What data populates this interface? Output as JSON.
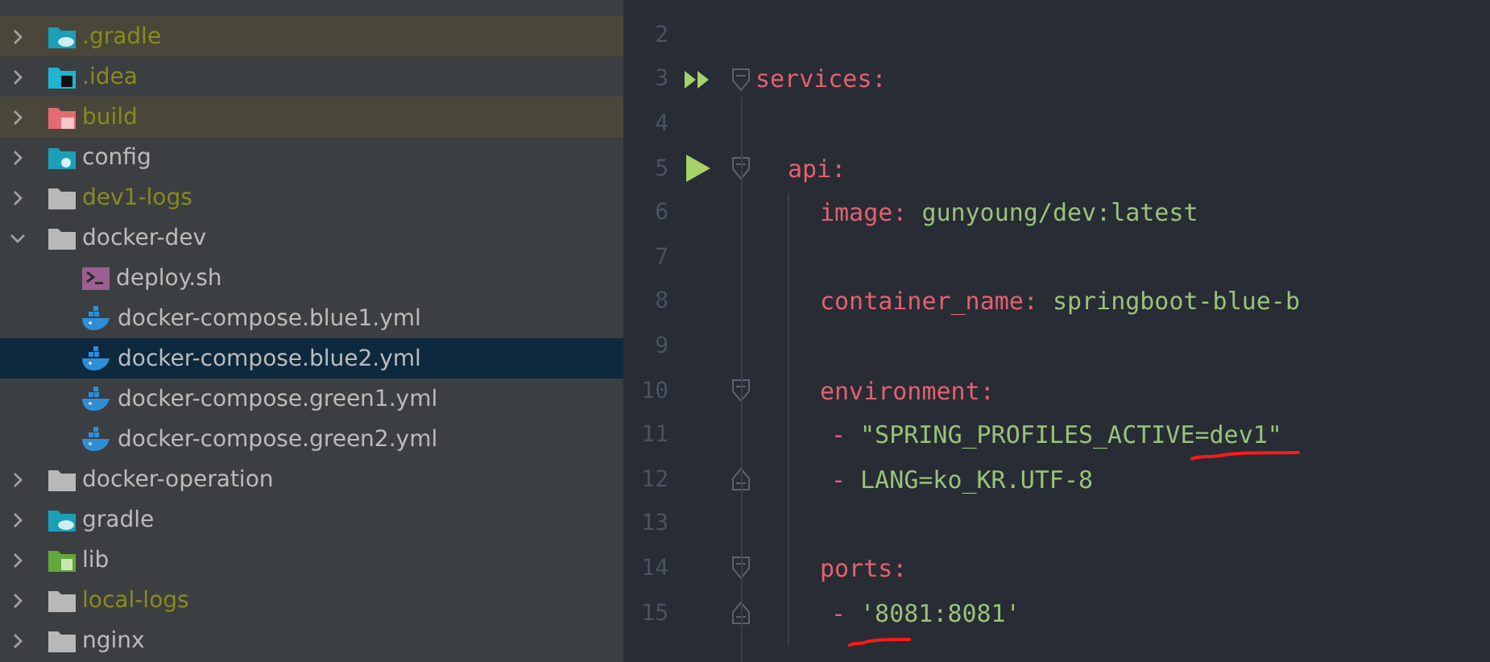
{
  "project_tree": {
    "items": [
      {
        "name": ".gradle",
        "kind": "gradle-folder",
        "expanded": false,
        "ignored": true,
        "highlighted": true,
        "selected": false
      },
      {
        "name": ".idea",
        "kind": "idea-folder",
        "expanded": false,
        "ignored": true,
        "highlighted": false,
        "selected": false
      },
      {
        "name": "build",
        "kind": "build-folder",
        "expanded": false,
        "ignored": true,
        "highlighted": true,
        "selected": false
      },
      {
        "name": "config",
        "kind": "config-folder",
        "expanded": false,
        "ignored": false,
        "highlighted": false,
        "selected": false
      },
      {
        "name": "dev1-logs",
        "kind": "folder",
        "expanded": false,
        "ignored": true,
        "highlighted": false,
        "selected": false
      },
      {
        "name": "docker-dev",
        "kind": "folder",
        "expanded": true,
        "ignored": false,
        "highlighted": false,
        "selected": false,
        "children": [
          {
            "name": "deploy.sh",
            "kind": "shell",
            "ignored": false,
            "highlighted": false,
            "selected": false
          },
          {
            "name": "docker-compose.blue1.yml",
            "kind": "docker",
            "ignored": false,
            "highlighted": false,
            "selected": false
          },
          {
            "name": "docker-compose.blue2.yml",
            "kind": "docker",
            "ignored": false,
            "highlighted": false,
            "selected": true
          },
          {
            "name": "docker-compose.green1.yml",
            "kind": "docker",
            "ignored": false,
            "highlighted": false,
            "selected": false
          },
          {
            "name": "docker-compose.green2.yml",
            "kind": "docker",
            "ignored": false,
            "highlighted": false,
            "selected": false
          }
        ]
      },
      {
        "name": "docker-operation",
        "kind": "folder",
        "expanded": false,
        "ignored": false,
        "highlighted": false,
        "selected": false
      },
      {
        "name": "gradle",
        "kind": "gradle-folder",
        "expanded": false,
        "ignored": false,
        "highlighted": false,
        "selected": false
      },
      {
        "name": "lib",
        "kind": "lib-folder",
        "expanded": false,
        "ignored": false,
        "highlighted": false,
        "selected": false
      },
      {
        "name": "local-logs",
        "kind": "folder",
        "expanded": false,
        "ignored": true,
        "highlighted": false,
        "selected": false
      },
      {
        "name": "nginx",
        "kind": "folder",
        "expanded": false,
        "ignored": false,
        "highlighted": false,
        "selected": false
      }
    ]
  },
  "editor": {
    "lines": [
      {
        "number": "2",
        "kind": "blank"
      },
      {
        "number": "3",
        "kind": "root",
        "run": {
          "kind": "run-all"
        },
        "fold": {
          "kind": "open"
        },
        "key": "services:"
      },
      {
        "number": "4",
        "kind": "blank"
      },
      {
        "number": "5",
        "kind": "service",
        "run": {
          "kind": "run"
        },
        "fold": {
          "kind": "open"
        },
        "key": "api:"
      },
      {
        "number": "6",
        "kind": "prop",
        "key": "image:",
        "value": "gunyoung/dev:latest"
      },
      {
        "number": "7",
        "kind": "blank"
      },
      {
        "number": "8",
        "kind": "prop",
        "key": "container_name:",
        "value": "springboot-blue-b"
      },
      {
        "number": "9",
        "kind": "blank"
      },
      {
        "number": "10",
        "kind": "prop",
        "fold": {
          "kind": "open"
        },
        "key": "environment:"
      },
      {
        "number": "11",
        "kind": "item",
        "dash": "-",
        "value": "\"SPRING_PROFILES_ACTIVE=dev1\"",
        "underlined": true
      },
      {
        "number": "12",
        "kind": "item",
        "fold": {
          "kind": "close"
        },
        "dash": "-",
        "value": "LANG=ko_KR.UTF-8"
      },
      {
        "number": "13",
        "kind": "blank"
      },
      {
        "number": "14",
        "kind": "prop",
        "fold": {
          "kind": "open"
        },
        "key": "ports:"
      },
      {
        "number": "15",
        "kind": "item",
        "fold": {
          "kind": "close"
        },
        "dash": "-",
        "value": "'8081:8081'",
        "underlined": true
      }
    ]
  }
}
